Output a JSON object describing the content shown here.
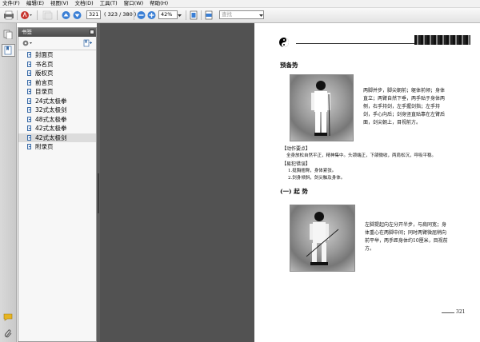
{
  "menu": [
    "文件(F)",
    "编辑(E)",
    "视图(V)",
    "文档(D)",
    "工具(T)",
    "窗口(W)",
    "帮助(H)"
  ],
  "toolbar": {
    "page_number": "321",
    "page_count": "( 323 / 380 )",
    "zoom": "42%",
    "search_placeholder": "查找"
  },
  "panel": {
    "title": "书签",
    "bookmarks": [
      {
        "label": "封面页"
      },
      {
        "label": "书名页"
      },
      {
        "label": "版权页"
      },
      {
        "label": "前言页"
      },
      {
        "label": "目录页"
      },
      {
        "label": "24式太极拳"
      },
      {
        "label": "32式太极剑"
      },
      {
        "label": "48式太极拳"
      },
      {
        "label": "42式太极拳"
      },
      {
        "label": "42式太极剑"
      },
      {
        "label": "附录页"
      }
    ],
    "selected_index": 9
  },
  "document": {
    "section_title": "预备势",
    "para1": "两脚并步，脚尖朝前；躯体前倾；身体直立；两臂自然下垂，两手贴于身体两侧，右手持剑，左手握剑指；左手持剑，手心向后；剑身竖直贴靠在左臂后面，剑尖朝上，目视前方。",
    "key_heading": "【动作要点】",
    "key_text": "全身放松自然平正，精神集中。头颈端正，下颌微收，两肩松沉，呼吸平稳。",
    "err_heading": "【易犯错误】",
    "err1": "1.挺胸翘臀，身体紧张。",
    "err2": "2.剑身倾斜，剑尖触及身体。",
    "subsection_title": "(一) 起 势",
    "para2": "左脚提起向左分开半步，与肩同宽；身体重心在两脚中间；同时两臂微屈稍向前平举，两手距身体约10厘米，目视前方。",
    "page_label": "321"
  }
}
